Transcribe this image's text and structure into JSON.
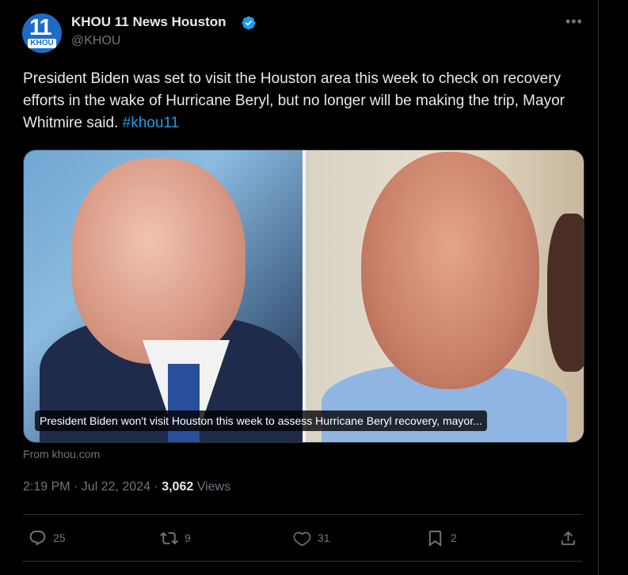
{
  "account": {
    "name": "KHOU 11 News Houston",
    "handle": "@KHOU",
    "avatar_number": "11",
    "avatar_brand": "KHOU"
  },
  "tweet": {
    "text": "President Biden was set to visit the Houston area this week to check on recovery efforts in the wake of Hurricane Beryl, but no longer will be making the trip, Mayor Whitmire said. ",
    "hashtag": "#khou11"
  },
  "card": {
    "caption": "President Biden won't visit Houston this week to assess Hurricane Beryl recovery, mayor...",
    "source": "From khou.com"
  },
  "meta": {
    "time_date": "2:19 PM · Jul 22, 2024 · ",
    "views_count": "3,062",
    "views_label": " Views"
  },
  "actions": {
    "replies": "25",
    "reposts": "9",
    "likes": "31",
    "bookmarks": "2"
  },
  "colors": {
    "background": "#000000",
    "text": "#e7e9ea",
    "muted": "#71767b",
    "accent": "#1d9bf0"
  }
}
